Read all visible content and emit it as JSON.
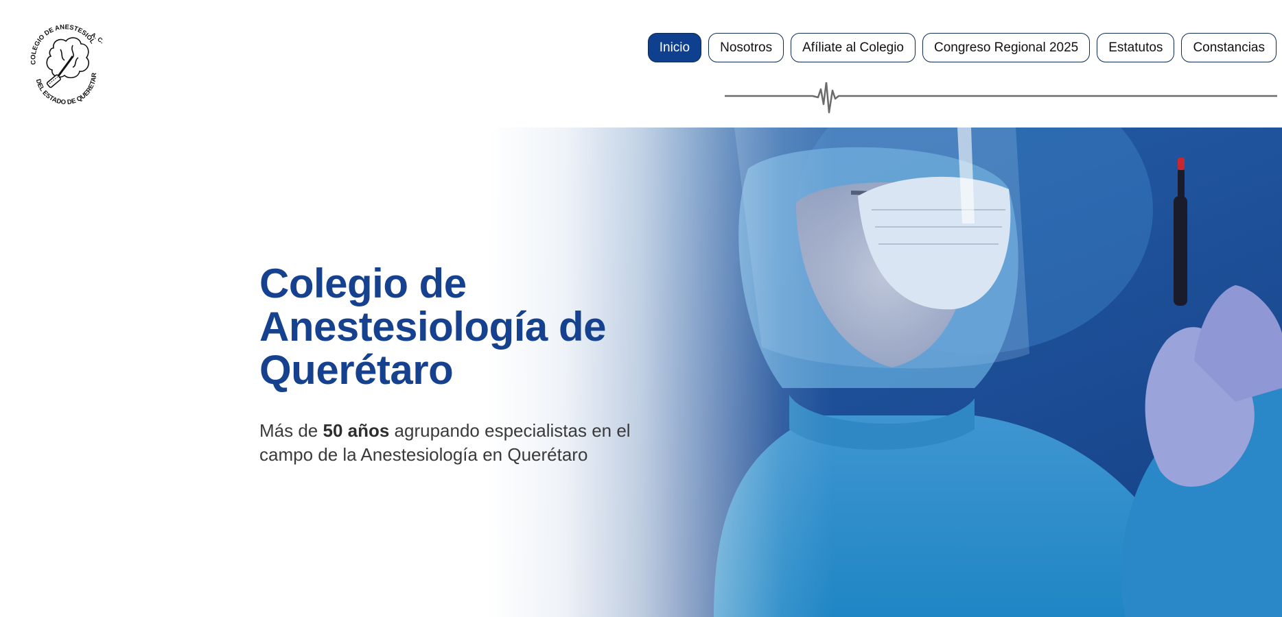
{
  "logo": {
    "ring_text_top": "COLEGIO DE ANESTESIOLOGIA",
    "ring_text_bottom": "DEL ESTADO DE QUERETARO",
    "ring_suffix": "A. C."
  },
  "nav": {
    "items": [
      {
        "label": "Inicio",
        "active": true
      },
      {
        "label": "Nosotros",
        "active": false
      },
      {
        "label": "Afíliate al Colegio",
        "active": false
      },
      {
        "label": "Congreso Regional 2025",
        "active": false
      },
      {
        "label": "Estatutos",
        "active": false
      },
      {
        "label": "Constancias",
        "active": false
      }
    ]
  },
  "hero": {
    "title_line1": "Colegio de",
    "title_line2": "Anestesiología de",
    "title_line3": "Querétaro",
    "subtitle_prefix": "Más de ",
    "subtitle_bold": "50 años",
    "subtitle_suffix": " agrupando especialistas en el campo de la Anestesiología en Querétaro",
    "image_subject": "anesthesiologist-with-syringe"
  },
  "colors": {
    "brand_blue": "#15418e",
    "active_nav_bg": "#0f3f8f",
    "pulse_line": "#6b6b6b"
  }
}
